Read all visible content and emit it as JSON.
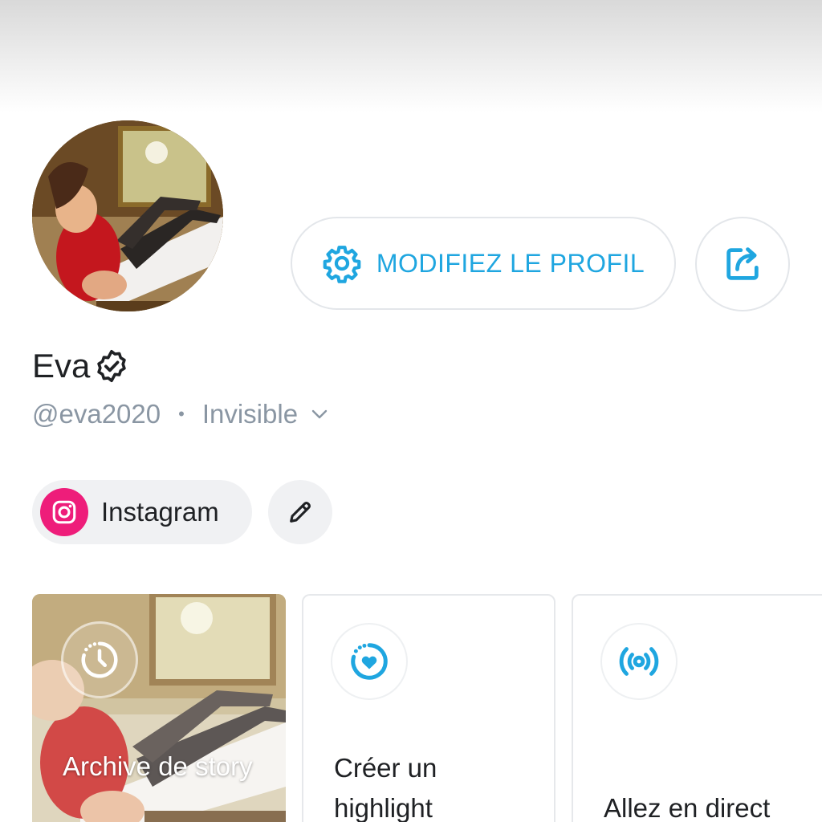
{
  "profile": {
    "name": "Eva",
    "handle": "@eva2020",
    "separator": "•",
    "visibility": "Invisible"
  },
  "actions": {
    "edit_profile_label": "MODIFIEZ LE PROFIL"
  },
  "social": {
    "instagram_label": "Instagram"
  },
  "cards": {
    "archive_label": "Archive de story",
    "highlight_label": "Créer un highlight",
    "live_label": "Allez en direct"
  },
  "colors": {
    "accent": "#1fa6e0",
    "instagram": "#ee1d7a",
    "muted_text": "#8a96a3",
    "text": "#1f2124"
  },
  "icons": {
    "edit_profile": "gear-icon",
    "share": "share-icon",
    "verified": "verified-badge-icon",
    "visibility_dropdown": "chevron-down-icon",
    "instagram": "instagram-icon",
    "edit_links": "pencil-icon",
    "archive": "clock-history-icon",
    "highlight": "heart-circle-icon",
    "live": "broadcast-icon"
  }
}
